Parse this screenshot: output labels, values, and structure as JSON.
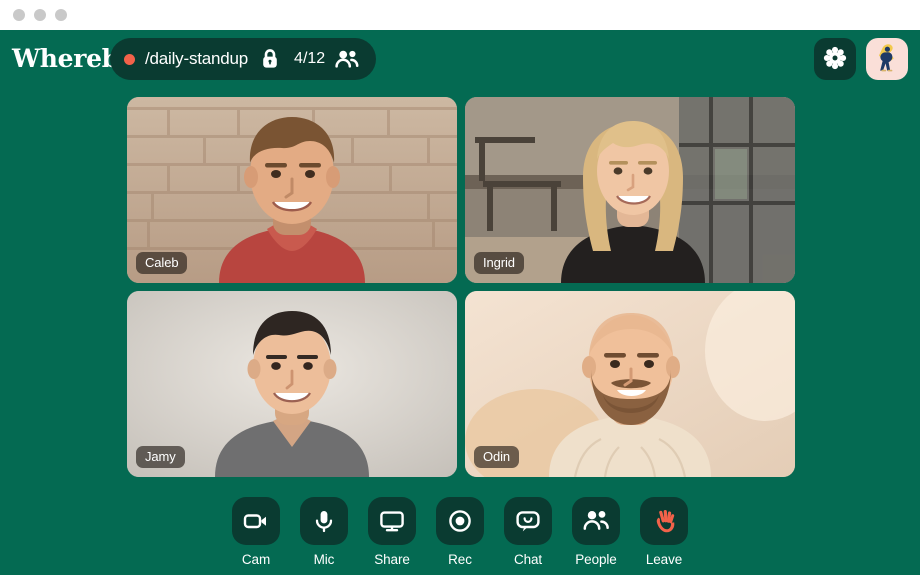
{
  "window": {
    "traffic_lights": [
      "close",
      "minimize",
      "maximize"
    ]
  },
  "topbar": {
    "brand": "Whereby",
    "room": {
      "recording_indicator": "rec-dot",
      "name": "/daily-standup",
      "lock_icon": "lock-icon",
      "participant_count": "4/12",
      "people_icon": "people-icon"
    },
    "settings_button": {
      "icon": "gear-icon",
      "label": "Settings"
    },
    "profile_button": {
      "icon": "avatar-illustration",
      "label": "Profile"
    }
  },
  "participants": [
    {
      "name": "Caleb",
      "position": "top-left"
    },
    {
      "name": "Ingrid",
      "position": "top-right"
    },
    {
      "name": "Jamy",
      "position": "bottom-left"
    },
    {
      "name": "Odin",
      "position": "bottom-right"
    }
  ],
  "toolbar": {
    "buttons": [
      {
        "label": "Cam",
        "icon": "video-camera-icon"
      },
      {
        "label": "Mic",
        "icon": "microphone-icon"
      },
      {
        "label": "Share",
        "icon": "screen-share-icon"
      },
      {
        "label": "Rec",
        "icon": "record-icon"
      },
      {
        "label": "Chat",
        "icon": "chat-bubble-icon"
      },
      {
        "label": "People",
        "icon": "people-icon"
      },
      {
        "label": "Leave",
        "icon": "waving-hand-icon"
      }
    ]
  },
  "colors": {
    "stage_green": "#046a52",
    "pill_green": "#0a3b31",
    "accent_coral": "#f2624a",
    "white": "#ffffff",
    "avatar_pink": "#fadfd8",
    "titlebar": "#ffffff"
  }
}
